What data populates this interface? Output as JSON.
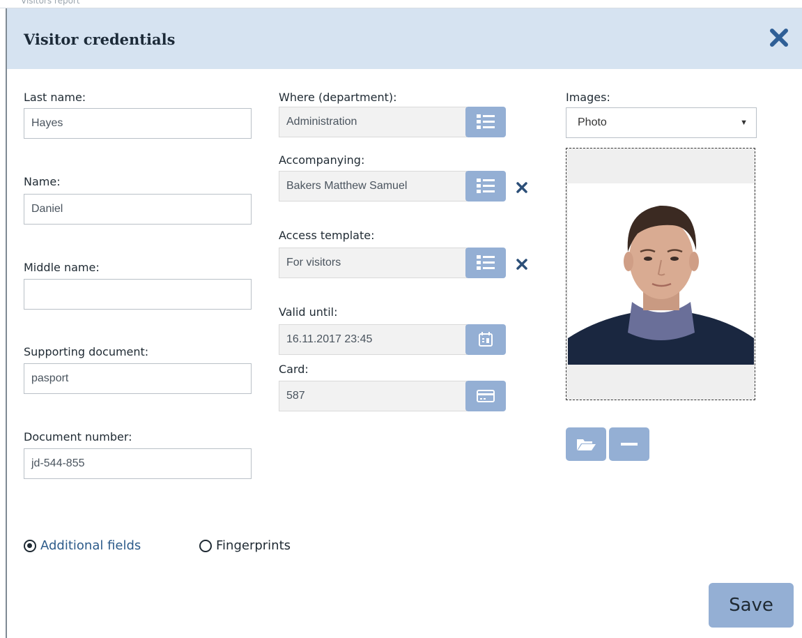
{
  "background_fragment": "Visitors report",
  "dialog": {
    "title": "Visitor credentials",
    "colors": {
      "header_bg": "#d6e3f1",
      "accent": "#94afd4",
      "close": "#2f5f96"
    }
  },
  "left_column": {
    "last_name": {
      "label": "Last name:",
      "value": "Hayes"
    },
    "name": {
      "label": "Name:",
      "value": "Daniel"
    },
    "middle_name": {
      "label": "Middle name:",
      "value": ""
    },
    "supporting_document": {
      "label": "Supporting document:",
      "value": "pasport"
    },
    "document_number": {
      "label": "Document number:",
      "value": "jd-544-855"
    }
  },
  "middle_column": {
    "department": {
      "label": "Where (department):",
      "value": "Administration",
      "icon": "list-icon"
    },
    "accompanying": {
      "label": "Accompanying:",
      "value": "Bakers Matthew Samuel",
      "icon": "list-icon"
    },
    "access_template": {
      "label": "Access template:",
      "value": "For visitors",
      "icon": "list-icon"
    },
    "valid_until": {
      "label": "Valid until:",
      "value": "16.11.2017 23:45",
      "icon": "calendar-icon"
    },
    "card": {
      "label": "Card:",
      "value": "587",
      "icon": "card-icon"
    }
  },
  "right_column": {
    "images_label": "Images:",
    "images_selected": "Photo",
    "buttons": [
      "folder-icon",
      "minus-icon"
    ]
  },
  "tabs": {
    "additional_fields": {
      "label": "Additional fields",
      "selected": true
    },
    "fingerprints": {
      "label": "Fingerprints",
      "selected": false
    }
  },
  "footer": {
    "save_label": "Save"
  }
}
